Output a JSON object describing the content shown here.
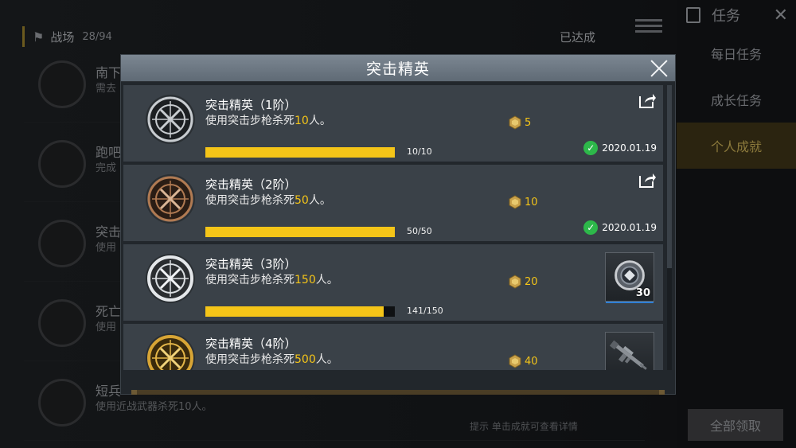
{
  "background": {
    "header": {
      "title": "战场",
      "count": "28/94",
      "status": "已达成"
    },
    "sidebar": {
      "title": "任务",
      "tabs": [
        "每日任务",
        "成长任务",
        "个人成就"
      ],
      "active_tab": "个人成就",
      "claim_all": "全部领取"
    },
    "rows": [
      {
        "title": "南下",
        "desc": "需去"
      },
      {
        "title": "跑吧",
        "desc": "完成"
      },
      {
        "title": "突击",
        "desc": "使用"
      },
      {
        "title": "死亡",
        "desc": "使用"
      },
      {
        "title": "短兵",
        "desc": "使用近战武器杀死10人。"
      }
    ],
    "footer_hint": "提示 单击成就可查看详情"
  },
  "modal": {
    "title": "突击精英",
    "achievements": [
      {
        "title": "突击精英（1阶）",
        "desc_prefix": "使用突击步枪杀死",
        "desc_number": "10",
        "desc_suffix": "人。",
        "reward": "5",
        "progress_text": "10/10",
        "progress": 1.0,
        "completed_date": "2020.01.19",
        "tier_color": "#c8ccd0"
      },
      {
        "title": "突击精英（2阶）",
        "desc_prefix": "使用突击步枪杀死",
        "desc_number": "50",
        "desc_suffix": "人。",
        "reward": "10",
        "progress_text": "50/50",
        "progress": 1.0,
        "completed_date": "2020.01.19",
        "tier_color": "#b07a52"
      },
      {
        "title": "突击精英（3阶）",
        "desc_prefix": "使用突击步枪杀死",
        "desc_number": "150",
        "desc_suffix": "人。",
        "reward": "20",
        "progress_text": "141/150",
        "progress": 0.94,
        "item_qty": "30",
        "item_icon": "emblem-icon",
        "tier_color": "#d9dde0"
      },
      {
        "title": "突击精英（4阶）",
        "desc_prefix": "使用突击步枪杀死",
        "desc_number": "500",
        "desc_suffix": "人。",
        "reward": "40",
        "item_icon": "rifle-icon",
        "tier_color": "#d8a535"
      }
    ]
  },
  "colors": {
    "accent": "#f5c518",
    "check": "#2db84a",
    "modal_header": "#6e7984"
  }
}
